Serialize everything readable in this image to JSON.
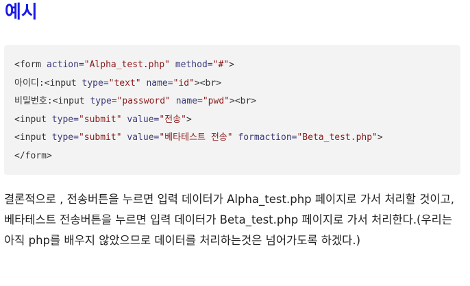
{
  "heading": "예시",
  "code": [
    [
      {
        "t": "<form ",
        "k": "tag"
      },
      {
        "t": "action=",
        "k": "attr"
      },
      {
        "t": "\"Alpha_test.php\"",
        "k": "str"
      },
      {
        "t": " ",
        "k": "tag"
      },
      {
        "t": "method=",
        "k": "attr"
      },
      {
        "t": "\"#\"",
        "k": "str"
      },
      {
        "t": ">",
        "k": "tag"
      }
    ],
    [
      {
        "t": "아이디:",
        "k": "text"
      },
      {
        "t": "<input ",
        "k": "tag"
      },
      {
        "t": "type=",
        "k": "attr"
      },
      {
        "t": "\"text\"",
        "k": "str"
      },
      {
        "t": " ",
        "k": "tag"
      },
      {
        "t": "name=",
        "k": "attr"
      },
      {
        "t": "\"id\"",
        "k": "str"
      },
      {
        "t": "><br>",
        "k": "tag"
      }
    ],
    [
      {
        "t": "비밀번호:",
        "k": "text"
      },
      {
        "t": "<input ",
        "k": "tag"
      },
      {
        "t": "type=",
        "k": "attr"
      },
      {
        "t": "\"password\"",
        "k": "str"
      },
      {
        "t": " ",
        "k": "tag"
      },
      {
        "t": "name=",
        "k": "attr"
      },
      {
        "t": "\"pwd\"",
        "k": "str"
      },
      {
        "t": "><br>",
        "k": "tag"
      }
    ],
    [
      {
        "t": "<input ",
        "k": "tag"
      },
      {
        "t": "type=",
        "k": "attr"
      },
      {
        "t": "\"submit\"",
        "k": "str"
      },
      {
        "t": " ",
        "k": "tag"
      },
      {
        "t": "value=",
        "k": "attr"
      },
      {
        "t": "\"전송\"",
        "k": "str"
      },
      {
        "t": ">",
        "k": "tag"
      }
    ],
    [
      {
        "t": "<input ",
        "k": "tag"
      },
      {
        "t": "type=",
        "k": "attr"
      },
      {
        "t": "\"submit\"",
        "k": "str"
      },
      {
        "t": " ",
        "k": "tag"
      },
      {
        "t": "value=",
        "k": "attr"
      },
      {
        "t": "\"베타테스트 전송\"",
        "k": "str"
      },
      {
        "t": " ",
        "k": "tag"
      },
      {
        "t": "formaction=",
        "k": "attr"
      },
      {
        "t": "\"Beta_test.php\"",
        "k": "str"
      },
      {
        "t": ">",
        "k": "tag"
      }
    ],
    [
      {
        "t": "</form>",
        "k": "tag"
      }
    ]
  ],
  "paragraph": "결론적으로 , 전송버튼을 누르면 입력 데이터가 Alpha_test.php 페이지로 가서 처리할 것이고, 베타테스트 전송버튼을 누르면 입력 데이터가 Beta_test.php 페이지로 가서 처리한다.(우리는 아직 php를 배우지 않았으므로 데이터를 처리하는것은 넘어가도록 하겠다.)"
}
